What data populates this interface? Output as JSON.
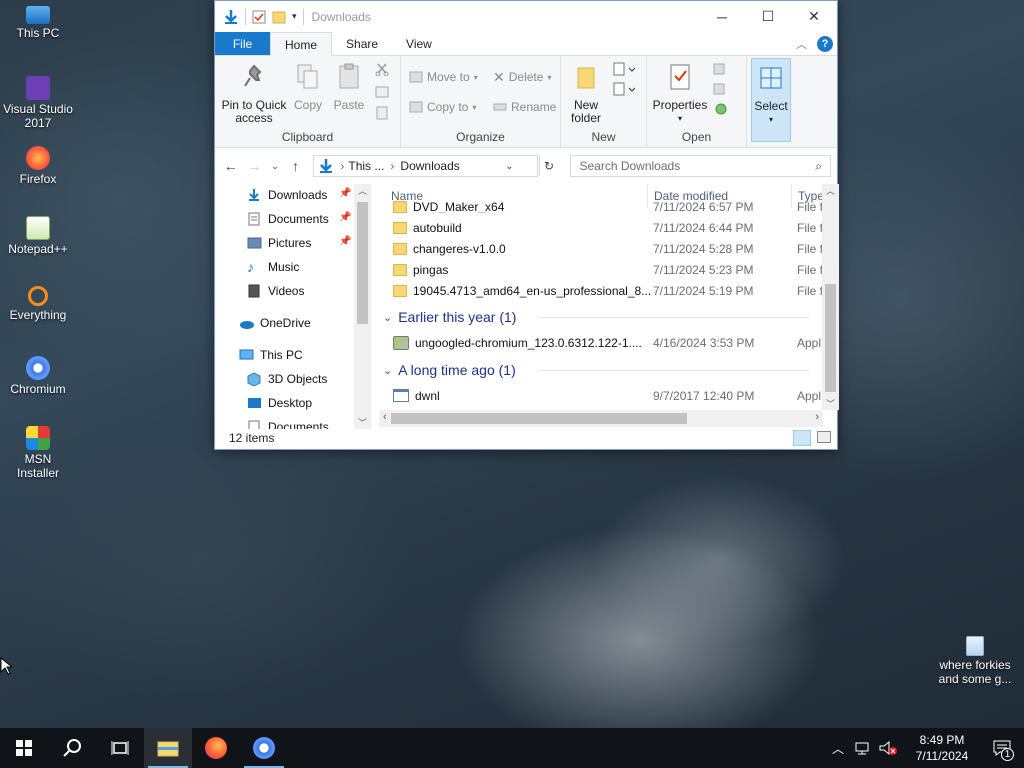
{
  "desktop": {
    "icons": [
      {
        "label": "This PC"
      },
      {
        "label": "Visual Studio 2017"
      },
      {
        "label": "Firefox"
      },
      {
        "label": "Notepad++"
      },
      {
        "label": "Everything"
      },
      {
        "label": "Chromium"
      },
      {
        "label": "MSN Installer"
      }
    ],
    "recycle_label": "where forkies and some g..."
  },
  "explorer": {
    "title": "Downloads",
    "tabs": {
      "file": "File",
      "home": "Home",
      "share": "Share",
      "view": "View"
    },
    "ribbon": {
      "pin_label": "Pin to Quick access",
      "copy_label": "Copy",
      "paste_label": "Paste",
      "clipboard_group": "Clipboard",
      "move_to": "Move to",
      "copy_to": "Copy to",
      "delete": "Delete",
      "rename": "Rename",
      "organize_group": "Organize",
      "new_folder": "New folder",
      "new_group": "New",
      "properties": "Properties",
      "open_group": "Open",
      "select": "Select"
    },
    "address": {
      "part1": "This ...",
      "sep": "›",
      "part2": "Downloads"
    },
    "search": {
      "placeholder": "Search Downloads"
    },
    "nav": {
      "items": [
        {
          "label": "Downloads"
        },
        {
          "label": "Documents"
        },
        {
          "label": "Pictures"
        },
        {
          "label": "Music"
        },
        {
          "label": "Videos"
        },
        {
          "label": "OneDrive"
        },
        {
          "label": "This PC"
        },
        {
          "label": "3D Objects"
        },
        {
          "label": "Desktop"
        },
        {
          "label": "Documents"
        }
      ]
    },
    "columns": {
      "name": "Name",
      "date": "Date modified",
      "type": "Type"
    },
    "rows": [
      {
        "name": "DVD_Maker_x64",
        "date": "7/11/2024 6:57 PM",
        "type": "File f"
      },
      {
        "name": "autobuild",
        "date": "7/11/2024 6:44 PM",
        "type": "File f"
      },
      {
        "name": "changeres-v1.0.0",
        "date": "7/11/2024 5:28 PM",
        "type": "File f"
      },
      {
        "name": "pingas",
        "date": "7/11/2024 5:23 PM",
        "type": "File f"
      },
      {
        "name": "19045.4713_amd64_en-us_professional_8...",
        "date": "7/11/2024 5:19 PM",
        "type": "File f"
      }
    ],
    "group_earlier": "Earlier this year (1)",
    "row_earlier": {
      "name": "ungoogled-chromium_123.0.6312.122-1....",
      "date": "4/16/2024 3:53 PM",
      "type": "Appl"
    },
    "group_long": "A long time ago (1)",
    "row_long": {
      "name": "dwnl",
      "date": "9/7/2017 12:40 PM",
      "type": "Appl"
    },
    "status": "12 items"
  },
  "taskbar": {
    "time": "8:49 PM",
    "date": "7/11/2024",
    "notification_count": "1"
  }
}
